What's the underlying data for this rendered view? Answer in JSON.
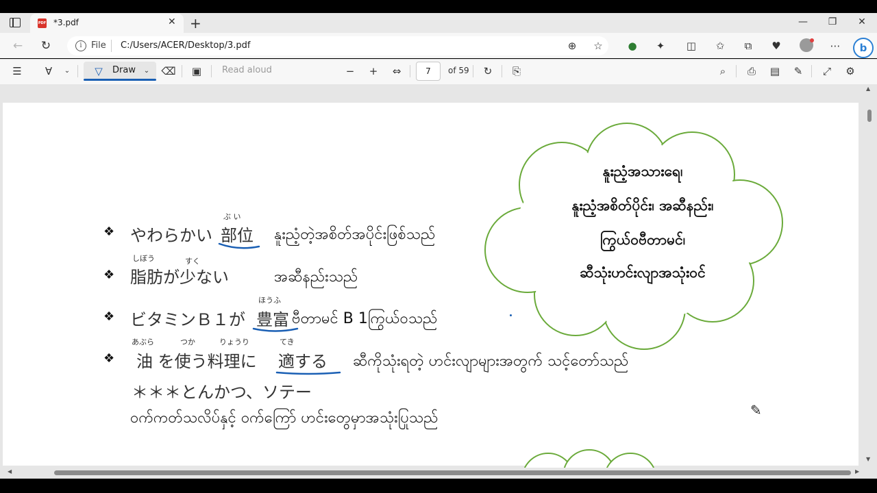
{
  "browser": {
    "tab_title": "*3.pdf",
    "pdf_icon_label": "PDF",
    "address_scheme_label": "File",
    "address_url": "C:/Users/ACER/Desktop/3.pdf",
    "bing_label": "b"
  },
  "pdf_toolbar": {
    "draw_label": "Draw",
    "read_aloud_label": "Read aloud",
    "current_page": "7",
    "page_total": "of 59"
  },
  "document": {
    "bullet_glyph": "❖",
    "items": [
      {
        "jp_prefix": "やわらかい",
        "jp_keyword": "部位",
        "ruby": "ぶ い",
        "myanmar": "နူးညံ့တဲ့အစိတ်အပိုင်းဖြစ်သည်"
      },
      {
        "jp_prefix": "脂肪が少ない",
        "ruby_1": "しぼう",
        "ruby_2": "すく",
        "myanmar": "အဆီနည်းသည်"
      },
      {
        "jp_prefix": "ビタミンＢ１が",
        "jp_keyword": "豊富",
        "ruby": "ほうふ",
        "myanmar": "ဗီတာမင် B 1ကြွယ်ဝသည်"
      },
      {
        "jp_prefix": "油 を使う料理に",
        "jp_keyword": "適する",
        "ruby_1": "あぶら",
        "ruby_2": "つか",
        "ruby_3": "りょうり",
        "ruby_4": "てき",
        "myanmar": "ဆီကိုသုံးရတဲ့ ဟင်းလျာများအတွက် သင့်တော်သည်"
      }
    ],
    "note_jp": "＊＊＊とんかつ、ソテー",
    "note_myanmar": "ဝက်ကတ်သလိပ်နှင့် ဝက်ကြော် ဟင်းတွေမှာအသုံးပြုသည်",
    "cloud_lines": [
      "နူးညံ့အသားရေ၊",
      "နူးညံ့အစိတ်ပိုင်း၊ အဆီနည်း၊",
      "ကြွယ်ဝဗီတာမင်၊",
      "ဆီသုံးဟင်းလျာအသုံးဝင်"
    ]
  },
  "colors": {
    "underline_blue": "#1a5fb4",
    "cloud_green": "#6aaa3a",
    "draw_accent": "#1a5fb4"
  }
}
